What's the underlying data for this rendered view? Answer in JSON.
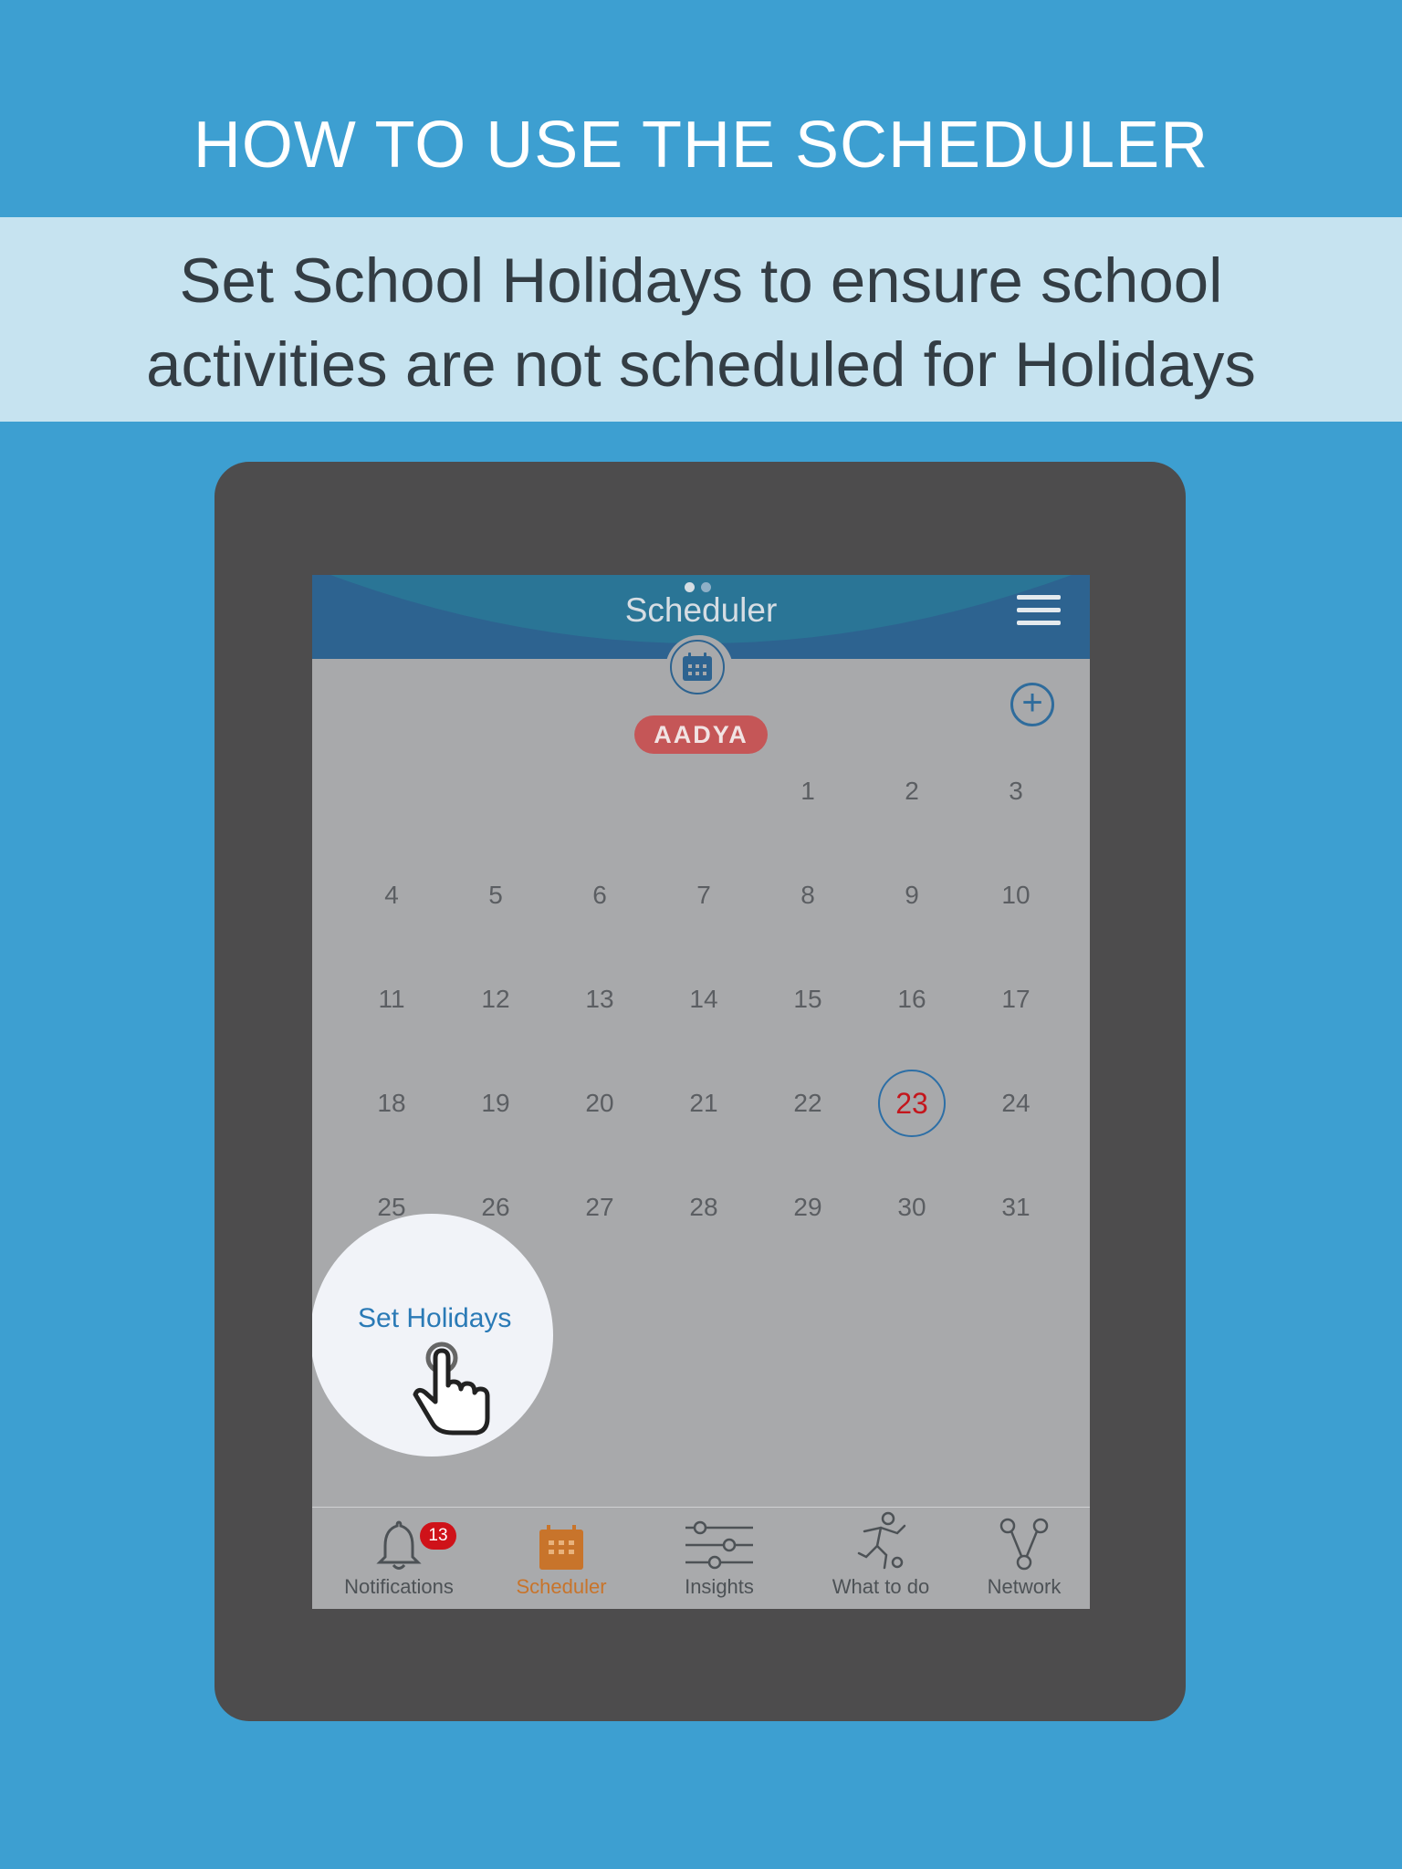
{
  "promo": {
    "title": "HOW TO USE THE SCHEDULER",
    "subtitle": "Set School Holidays to ensure school\nactivities are not scheduled for Holidays"
  },
  "app": {
    "header_title": "Scheduler",
    "student_name": "AADYA",
    "today": "23",
    "days": [
      "",
      "",
      "",
      "",
      "1",
      "2",
      "3",
      "4",
      "5",
      "6",
      "7",
      "8",
      "9",
      "10",
      "11",
      "12",
      "13",
      "14",
      "15",
      "16",
      "17",
      "18",
      "19",
      "20",
      "21",
      "22",
      "23",
      "24",
      "25",
      "26",
      "27",
      "28",
      "29",
      "30",
      "31"
    ],
    "set_holidays_label": "Set Holidays",
    "nav": [
      {
        "label": "Notifications",
        "icon": "bell-icon",
        "badge": "13"
      },
      {
        "label": "Scheduler",
        "icon": "calendar-icon",
        "active": true
      },
      {
        "label": "Insights",
        "icon": "sliders-icon"
      },
      {
        "label": "What to do",
        "icon": "soccer-player-icon"
      },
      {
        "label": "Network",
        "icon": "network-icon"
      }
    ]
  },
  "colors": {
    "background": "#3d9fd1",
    "header": "#2d6390",
    "active_tab": "#c8742b",
    "today_text": "#c4161c",
    "badge": "#cf1219"
  }
}
